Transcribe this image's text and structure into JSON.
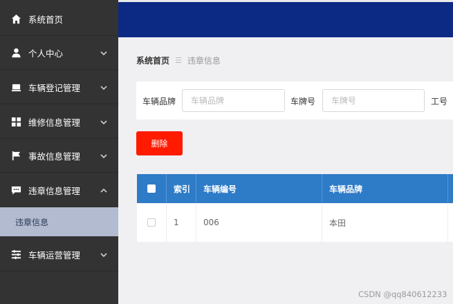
{
  "sidebar": {
    "items": [
      {
        "label": "系统首页",
        "icon": "home-icon",
        "expandable": false
      },
      {
        "label": "个人中心",
        "icon": "user-icon",
        "expandable": true,
        "expanded": false
      },
      {
        "label": "车辆登记管理",
        "icon": "car-register-icon",
        "expandable": true,
        "expanded": false
      },
      {
        "label": "维修信息管理",
        "icon": "grid-icon",
        "expandable": true,
        "expanded": false
      },
      {
        "label": "事故信息管理",
        "icon": "flag-icon",
        "expandable": true,
        "expanded": false
      },
      {
        "label": "违章信息管理",
        "icon": "chat-icon",
        "expandable": true,
        "expanded": true
      },
      {
        "label": "车辆运营管理",
        "icon": "list-icon",
        "expandable": true,
        "expanded": false
      }
    ],
    "active_sub": "违章信息"
  },
  "breadcrumb": {
    "home": "系统首页",
    "separator": "☰",
    "current": "违章信息"
  },
  "search": {
    "brand_label": "车辆品牌",
    "brand_placeholder": "车辆品牌",
    "plate_label": "车牌号",
    "plate_placeholder": "车牌号",
    "job_label": "工号"
  },
  "actions": {
    "delete_label": "删除"
  },
  "table": {
    "columns": [
      "索引",
      "车辆编号",
      "车辆品牌"
    ],
    "rows": [
      {
        "index": "1",
        "vehicle_no": "006",
        "brand": "本田"
      }
    ]
  },
  "watermark": "CSDN @qq840612233",
  "colors": {
    "sidebar_bg": "#333333",
    "header_bg": "#0c2a83",
    "table_header": "#2e7bc7",
    "delete_button": "#ff1a00",
    "active_sub_bg": "#b2bbd0"
  }
}
